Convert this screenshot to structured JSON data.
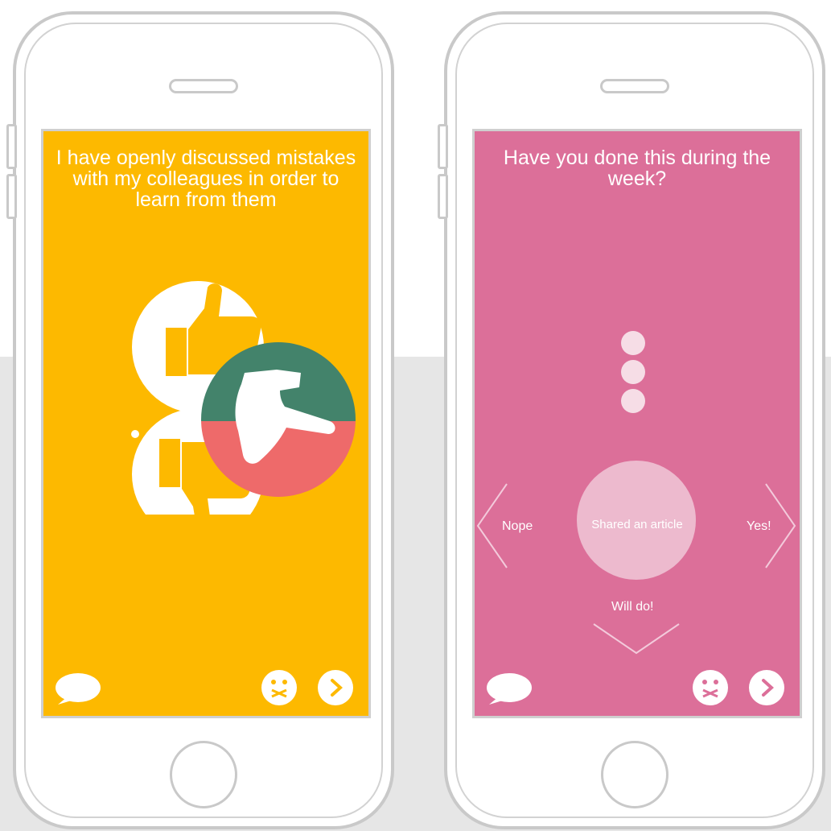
{
  "colors": {
    "left_screen": "#fdb900",
    "right_screen": "#dc6f99",
    "green": "#43836b",
    "red": "#ee6a6a",
    "white": "#ffffff"
  },
  "left_phone": {
    "title": "I have openly discussed mistakes with my colleagues in order to learn from them",
    "illustration_icons": [
      "thumbs-up-icon",
      "thumbs-down-icon",
      "pointing-hand-icon"
    ],
    "bottom_icons": [
      "speech-bubble-icon",
      "zipped-mouth-face-icon",
      "chevron-right-icon"
    ]
  },
  "right_phone": {
    "title": "Have you done this during the week?",
    "card_label": "Shared an article",
    "left_label": "Nope",
    "right_label": "Yes!",
    "bottom_label": "Will do!",
    "bottom_icons": [
      "speech-bubble-icon",
      "zipped-mouth-face-icon",
      "chevron-right-icon"
    ]
  }
}
